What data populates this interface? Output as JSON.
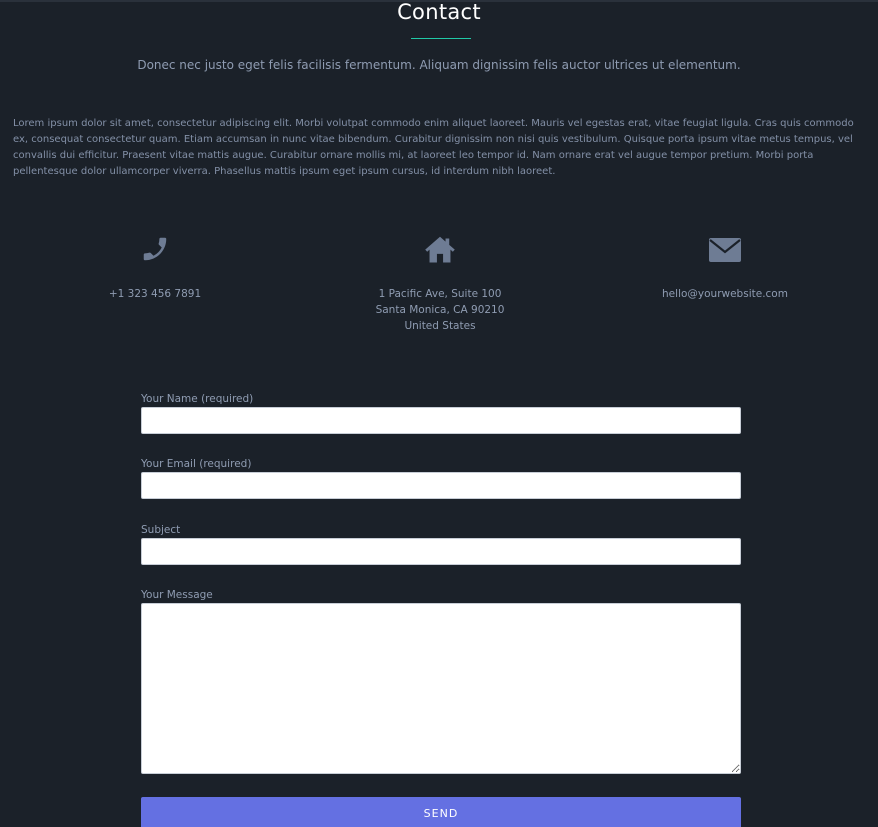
{
  "header": {
    "title": "Contact",
    "subtitle": "Donec nec justo eget felis facilisis fermentum. Aliquam dignissim felis auctor ultrices ut elementum.",
    "accent_color": "#21c9a7"
  },
  "intro": "Lorem ipsum dolor sit amet, consectetur adipiscing elit. Morbi volutpat commodo enim aliquet laoreet. Mauris vel egestas erat, vitae feugiat ligula. Cras quis commodo ex, consequat consectetur quam. Etiam accumsan in nunc vitae bibendum. Curabitur dignissim non nisi quis vestibulum. Quisque porta ipsum vitae metus tempus, vel convallis dui efficitur. Praesent vitae mattis augue. Curabitur ornare mollis mi, at laoreet leo tempor id. Nam ornare erat vel augue tempor pretium. Morbi porta pellentesque dolor ullamcorper viverra. Phasellus mattis ipsum eget ipsum cursus, id interdum nibh laoreet.",
  "contact_info": {
    "phone": {
      "icon": "phone-icon",
      "value": "+1 323 456 7891"
    },
    "address": {
      "icon": "home-icon",
      "line1": "1 Pacific Ave, Suite 100",
      "line2": "Santa Monica, CA 90210",
      "line3": "United States"
    },
    "email": {
      "icon": "envelope-icon",
      "value": "hello@yourwebsite.com"
    },
    "icon_color": "#6e7c94"
  },
  "form": {
    "name_label": "Your Name (required)",
    "name_value": "",
    "email_label": "Your Email (required)",
    "email_value": "",
    "subject_label": "Subject",
    "subject_value": "",
    "message_label": "Your Message",
    "message_value": "",
    "send_label": "SEND",
    "send_color": "#6470e2"
  },
  "colors": {
    "background": "#1b2129",
    "text_muted": "#8f9cb2"
  }
}
